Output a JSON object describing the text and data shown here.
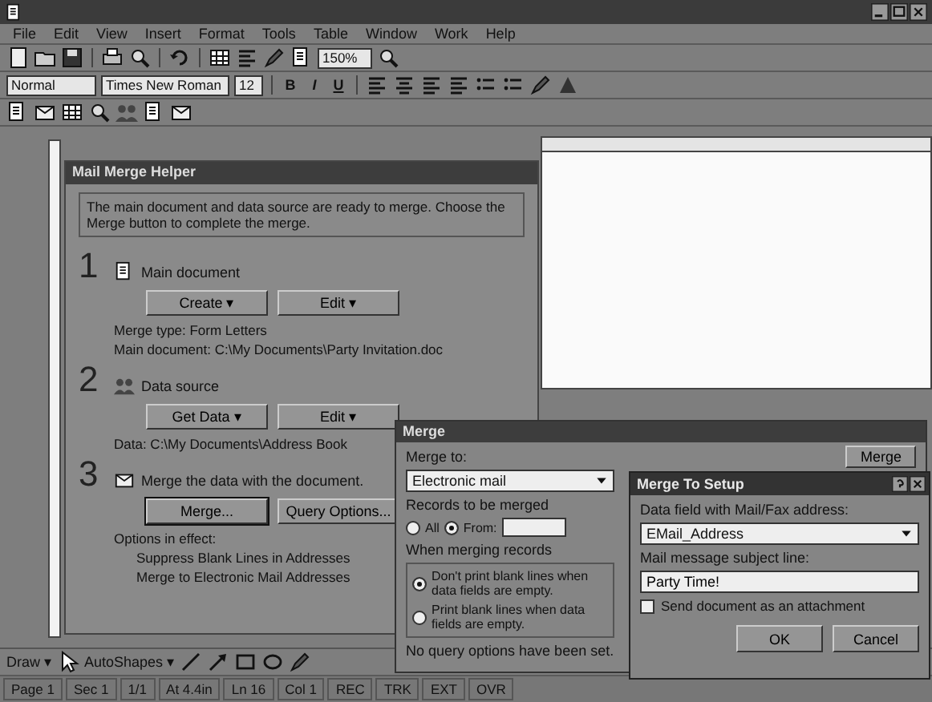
{
  "menu": [
    "File",
    "Edit",
    "View",
    "Insert",
    "Format",
    "Tools",
    "Table",
    "Window",
    "Work",
    "Help"
  ],
  "standard_toolbar": {
    "zoom": "150%"
  },
  "formatting_toolbar": {
    "style": "Normal",
    "font": "Times New Roman",
    "size": "12",
    "emphasis": [
      "B",
      "I",
      "U"
    ]
  },
  "helper": {
    "title": "Mail Merge Helper",
    "intro": "The main document and data source are ready to merge. Choose the Merge button to complete the merge.",
    "steps": [
      {
        "number": "1",
        "heading": "Main document",
        "buttons": [
          {
            "label": "Create ▾",
            "default": false
          },
          {
            "label": "Edit ▾",
            "default": false
          }
        ],
        "info": [
          "Merge type: Form Letters",
          "Main document: C:\\My Documents\\Party Invitation.doc"
        ]
      },
      {
        "number": "2",
        "heading": "Data source",
        "buttons": [
          {
            "label": "Get Data ▾",
            "default": false
          },
          {
            "label": "Edit ▾",
            "default": false
          }
        ],
        "info": [
          "Data: C:\\My Documents\\Address Book"
        ]
      },
      {
        "number": "3",
        "heading": "Merge the data with the document.",
        "buttons": [
          {
            "label": "Merge...",
            "default": true
          },
          {
            "label": "Query Options...",
            "default": false
          }
        ],
        "info": [
          "Options in effect:"
        ],
        "options": [
          "Suppress Blank Lines in Addresses",
          "Merge to Electronic Mail Addresses"
        ]
      }
    ]
  },
  "merge_dialog": {
    "title": "Merge",
    "merge_to_label": "Merge to:",
    "merge_to": "Electronic mail",
    "records_label": "Records to be merged",
    "records": [
      {
        "label": "All",
        "selected": false
      },
      {
        "label": "From:",
        "selected": true
      }
    ],
    "when_label": "When merging records",
    "when": [
      {
        "label": "Don't print blank lines when data fields are empty.",
        "selected": true
      },
      {
        "label": "Print blank lines when data fields are empty.",
        "selected": false
      }
    ],
    "note": "No query options have been set.",
    "button": "Merge"
  },
  "setup_dialog": {
    "title": "Merge To Setup",
    "field_label": "Data field with Mail/Fax address:",
    "field_value": "EMail_Address",
    "subject_label": "Mail message subject line:",
    "subject_value": "Party Time!",
    "attachment": {
      "label": "Send document as an attachment",
      "checked": false
    },
    "buttons": [
      "OK",
      "Cancel"
    ]
  },
  "drawing_toolbar": {
    "draw": "Draw ▾",
    "autoshapes": "AutoShapes ▾"
  },
  "status_bar": [
    "Page 1",
    "Sec 1",
    "1/1",
    "At 4.4in",
    "Ln 16",
    "Col 1",
    "REC",
    "TRK",
    "EXT",
    "OVR"
  ]
}
